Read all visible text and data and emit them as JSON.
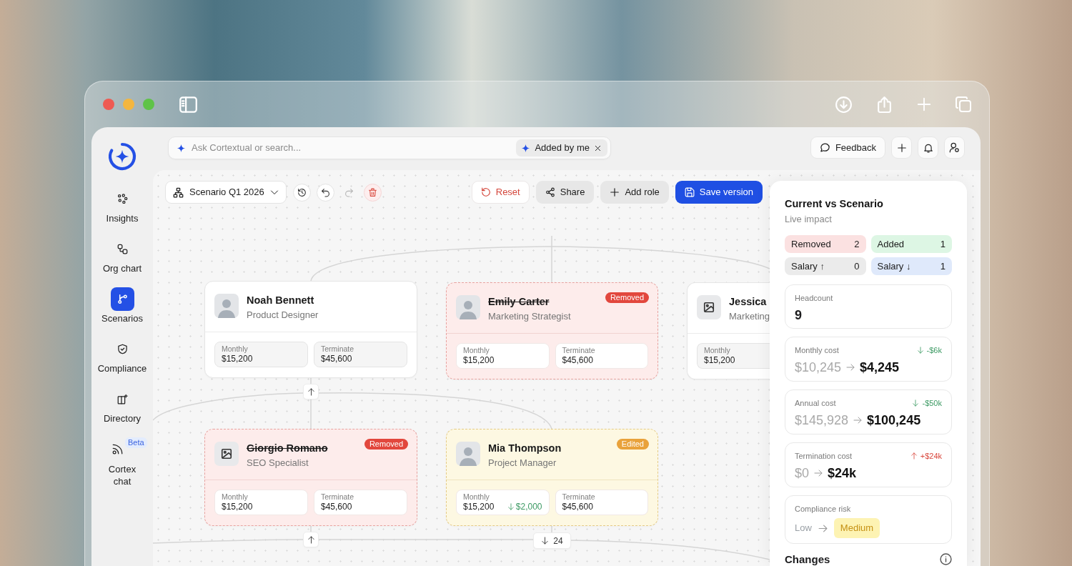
{
  "sidebar": {
    "items": [
      {
        "kind": "insights",
        "label": "Insights",
        "selected": false
      },
      {
        "kind": "org_chart",
        "label": "Org chart",
        "selected": false
      },
      {
        "kind": "scenarios",
        "label": "Scenarios",
        "selected": true
      },
      {
        "kind": "compliance",
        "label": "Compliance",
        "selected": false
      },
      {
        "kind": "directory",
        "label": "Directory",
        "selected": false
      },
      {
        "kind": "chat",
        "label": "Cortex chat",
        "badge": "Beta",
        "selected": false
      }
    ]
  },
  "top_bar": {
    "search": {
      "placeholder": "Ask Cortextual or search..."
    },
    "filter_chip": {
      "label": "Added by me"
    },
    "feedback_button": {
      "label": "Feedback"
    }
  },
  "toolbar": {
    "scenario_select": {
      "value": "Scenario Q1 2026"
    },
    "icon_buttons": [
      {
        "kind": "history",
        "disabled": false
      },
      {
        "kind": "undo",
        "disabled": false
      },
      {
        "kind": "redo",
        "disabled": true
      },
      {
        "kind": "delete",
        "disabled": false
      }
    ],
    "actions": [
      {
        "kind": "reset",
        "label": "Reset"
      },
      {
        "kind": "share",
        "label": "Share"
      },
      {
        "kind": "add",
        "label": "Add role"
      },
      {
        "kind": "save",
        "label": "Save version"
      }
    ]
  },
  "org_chart": {
    "nodes": [
      {
        "name": "Noah Bennett",
        "role": "Product Designer",
        "removed": false,
        "edited": false,
        "photo": true,
        "metrics": [
          {
            "label": "Monthly",
            "value": "$15,200"
          },
          {
            "label": "Terminate",
            "value": "$45,600"
          }
        ],
        "toggle": {
          "expanded": true
        }
      },
      {
        "name": "Emily Carter",
        "role": "Marketing Strategist",
        "removed": true,
        "edited": false,
        "badge": "Removed",
        "photo": true,
        "metrics": [
          {
            "label": "Monthly",
            "value": "$15,200"
          },
          {
            "label": "Terminate",
            "value": "$45,600"
          }
        ]
      },
      {
        "name": "Jessica",
        "role": "Marketing",
        "removed": false,
        "edited": false,
        "photo": false,
        "metrics": [
          {
            "label": "Monthly",
            "value": "$15,200"
          }
        ]
      },
      {
        "name": "Giorgio Romano",
        "role": "SEO Specialist",
        "removed": true,
        "edited": false,
        "badge": "Removed",
        "photo": false,
        "metrics": [
          {
            "label": "Monthly",
            "value": "$15,200"
          },
          {
            "label": "Terminate",
            "value": "$45,600"
          }
        ],
        "toggle": {
          "expanded": true
        }
      },
      {
        "name": "Mia Thompson",
        "role": "Project Manager",
        "removed": false,
        "edited": true,
        "badge": "Edited",
        "photo": true,
        "metrics": [
          {
            "label": "Monthly",
            "value": "$15,200",
            "change": "$2,000",
            "increase": false
          },
          {
            "label": "Terminate",
            "value": "$45,600"
          }
        ],
        "toggle": {
          "expanded": false,
          "count": "24"
        }
      }
    ]
  },
  "impact_panel": {
    "title": "Current vs Scenario",
    "subtitle": "Live impact",
    "summary": [
      {
        "label": "Removed",
        "count": "2",
        "color": "#fbe1e1"
      },
      {
        "label": "Added",
        "count": "1",
        "color": "#ddf6e4"
      },
      {
        "label": "Salary ↑",
        "count": "0",
        "color": "#ebebeb"
      },
      {
        "label": "Salary ↓",
        "count": "1",
        "color": "#dfe9fb"
      }
    ],
    "metrics": [
      {
        "kind": "count",
        "label": "Headcount",
        "value": "9"
      },
      {
        "kind": "change",
        "label": "Monthly cost",
        "from": "$10,245",
        "to": "$4,245",
        "delta": "-$6k",
        "increase": false
      },
      {
        "kind": "change",
        "label": "Annual cost",
        "from": "$145,928",
        "to": "$100,245",
        "delta": "-$50k",
        "increase": false
      },
      {
        "kind": "change",
        "label": "Termination cost",
        "from": "$0",
        "to": "$24k",
        "delta": "+$24k",
        "increase": true
      },
      {
        "kind": "risk",
        "label": "Compliance risk",
        "from": "Low",
        "to": "Medium"
      }
    ],
    "changes": {
      "title": "Changes"
    }
  }
}
